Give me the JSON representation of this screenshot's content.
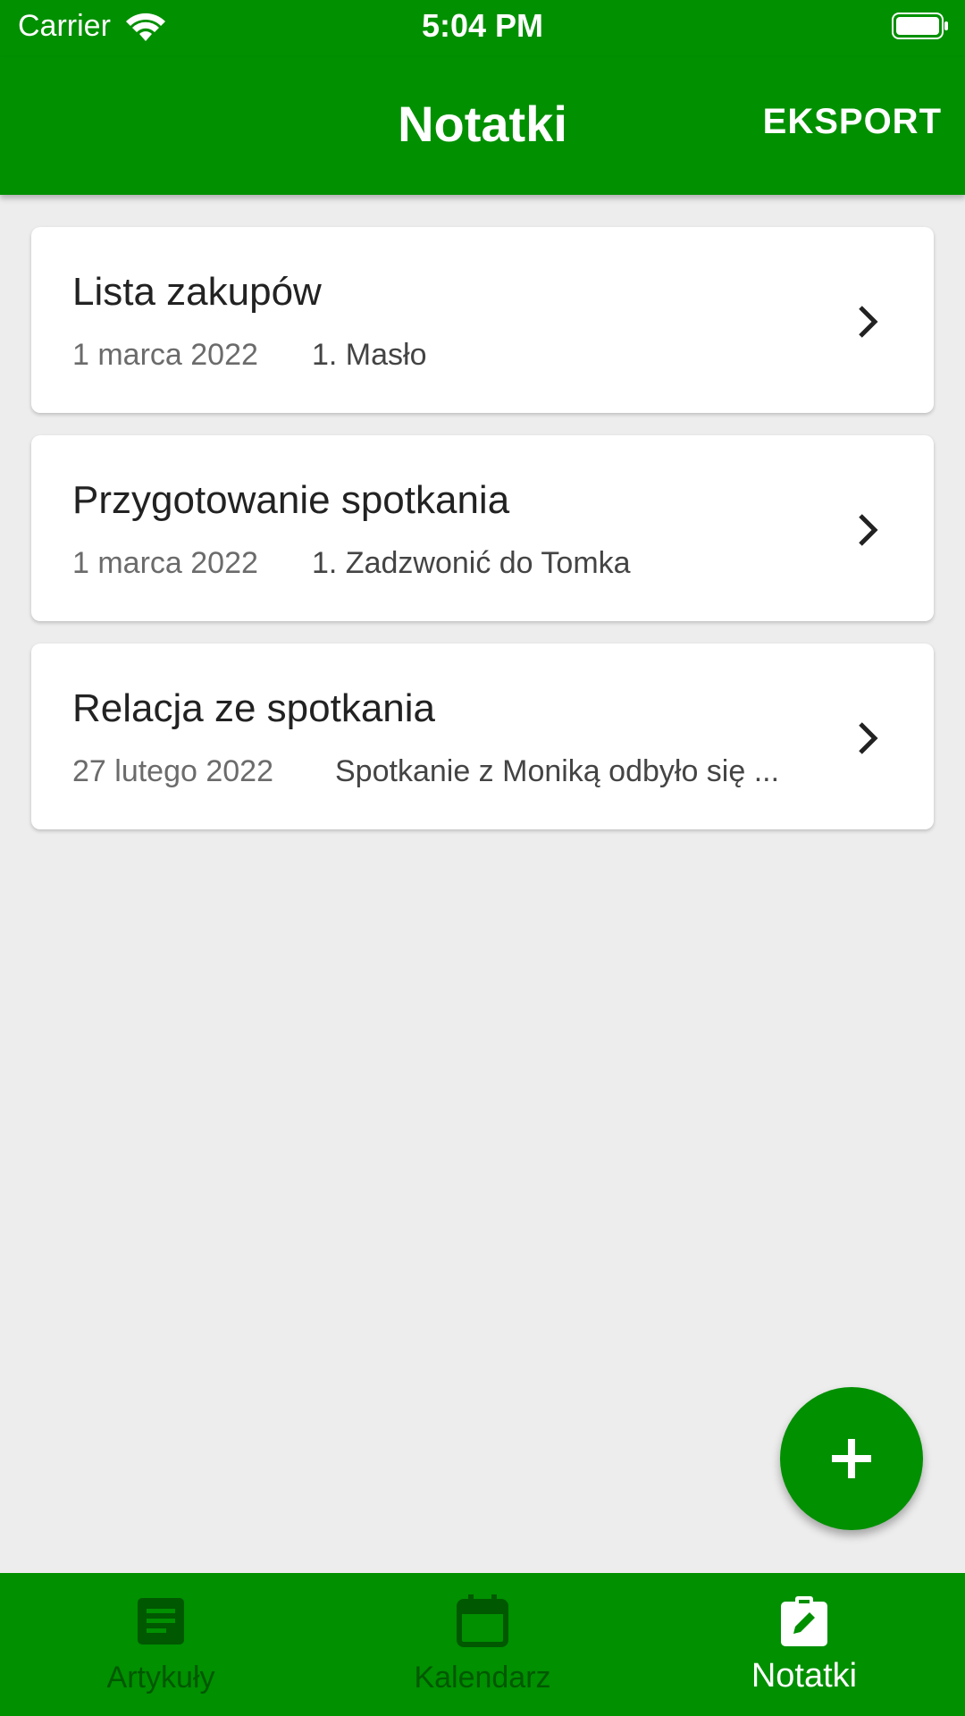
{
  "status_bar": {
    "carrier": "Carrier",
    "time": "5:04 PM"
  },
  "header": {
    "title": "Notatki",
    "export_label": "EKSPORT"
  },
  "notes": [
    {
      "title": "Lista zakupów",
      "date": "1 marca 2022",
      "preview": "1. Masło"
    },
    {
      "title": "Przygotowanie spotkania",
      "date": "1 marca 2022",
      "preview": "1. Zadzwonić do Tomka"
    },
    {
      "title": "Relacja ze spotkania",
      "date": "27 lutego 2022",
      "preview": "Spotkanie z Moniką odbyło się ..."
    }
  ],
  "fab": {
    "icon": "plus-icon"
  },
  "bottom_nav": {
    "items": [
      {
        "label": "Artykuły",
        "icon": "article-icon",
        "active": false
      },
      {
        "label": "Kalendarz",
        "icon": "calendar-icon",
        "active": false
      },
      {
        "label": "Notatki",
        "icon": "note-edit-icon",
        "active": true
      }
    ]
  },
  "colors": {
    "primary": "#009000",
    "inactive_nav": "#005800",
    "background": "#ededed"
  }
}
